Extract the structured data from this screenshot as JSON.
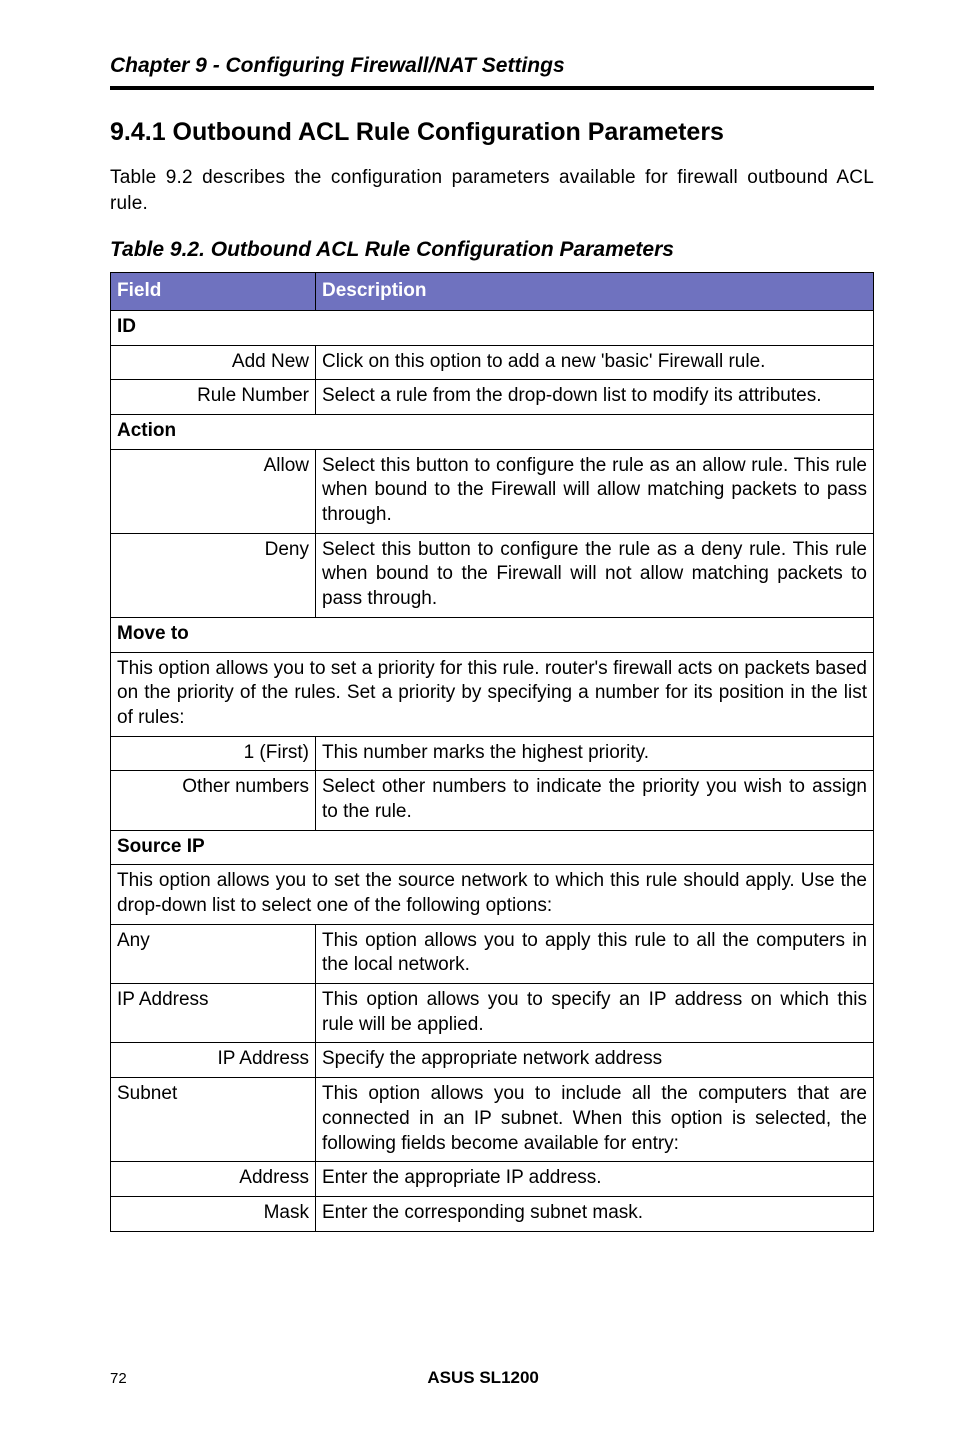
{
  "running_head": "Chapter 9 - Configuring Firewall/NAT Settings",
  "section_title": "9.4.1 Outbound ACL Rule Configuration Parameters",
  "intro": "Table 9.2 describes the configuration parameters available for firewall outbound ACL rule.",
  "table_caption": "Table 9.2. Outbound ACL Rule Configuration Parameters",
  "header": {
    "field": "Field",
    "description": "Description"
  },
  "rows": {
    "id_section": "ID",
    "add_new_label": "Add New",
    "add_new_desc": "Click on this option to add a new 'basic' Firewall rule.",
    "rule_number_label": "Rule Number",
    "rule_number_desc": "Select a rule from the drop-down list to modify its attributes.",
    "action_section": "Action",
    "allow_label": "Allow",
    "allow_desc": "Select this button to configure the rule as an allow rule. This rule when bound to the Firewall will allow matching packets to pass through.",
    "deny_label": "Deny",
    "deny_desc": "Select this button to configure the rule as a deny rule. This rule when bound to the Firewall will not allow matching packets to pass through.",
    "move_to_section": "Move to",
    "move_to_desc": "This option allows you to set a priority for this rule. router's firewall acts on packets based on the priority of the rules. Set a priority by specifying a number for its position in the list of rules:",
    "first_label": "1 (First)",
    "first_desc": "This number marks the highest priority.",
    "other_numbers_label": "Other numbers",
    "other_numbers_desc": "Select other numbers to indicate the priority you wish to assign to the rule.",
    "source_ip_section": "Source IP",
    "source_ip_desc": "This option allows you to set the source network to which this rule should apply. Use the drop-down list to select one of the following options:",
    "any_label": "Any",
    "any_desc": "This option allows you to apply this rule to all the computers in the local network.",
    "ip_address_label": "IP Address",
    "ip_address_desc": "This option allows you to specify an IP address on which this rule will be applied.",
    "ip_address_sub_label": "IP Address",
    "ip_address_sub_desc": "Specify the appropriate network address",
    "subnet_label": "Subnet",
    "subnet_desc": "This option allows you to include all the computers that are connected in an IP subnet. When this option is selected, the following fields become available for entry:",
    "address_label": "Address",
    "address_desc": "Enter the appropriate IP address.",
    "mask_label": "Mask",
    "mask_desc": "Enter the corresponding subnet mask."
  },
  "footer": {
    "page": "72",
    "title": "ASUS SL1200"
  }
}
